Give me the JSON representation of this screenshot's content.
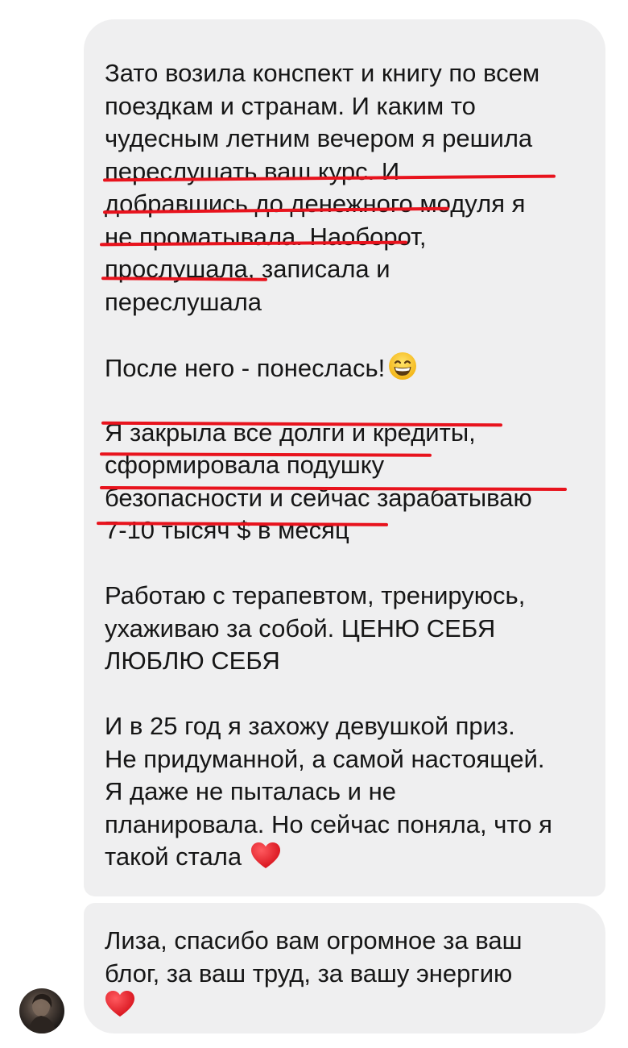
{
  "messages": [
    {
      "paragraphs": [
        {
          "lines": [
            "Зато возила конспект и книгу по всем",
            "поездкам и странам. И каким то",
            "чудесным летним вечером я решила",
            "переслушать ваш курс. И",
            "добравшись до денежного модуля я",
            "не проматывала. Наоборот,",
            "прослушала, записала и",
            "переслушала"
          ]
        },
        {
          "lines": [
            "После него - понеслась!"
          ],
          "emoji": "grinning-face-emoji"
        },
        {
          "lines": [
            "Я закрыла все долги и кредиты,",
            "сформировала подушку",
            "безопасности и сейчас зарабатываю",
            "7-10 тысяч $ в месяц"
          ]
        },
        {
          "lines": [
            "Работаю с терапевтом, тренируюсь,",
            "ухаживаю за собой. ЦЕНЮ СЕБЯ",
            "ЛЮБЛЮ СЕБЯ"
          ]
        },
        {
          "lines": [
            "И в 25 год я захожу девушкой приз.",
            "Не придуманной, а самой настоящей.",
            "Я даже не пыталась и не",
            "планировала. Но сейчас поняла, что я",
            "такой стала"
          ],
          "emoji": "red-heart-emoji"
        }
      ]
    },
    {
      "paragraphs": [
        {
          "lines": [
            "Лиза, спасибо вам огромное за ваш",
            "блог, за ваш труд, за вашу энергию"
          ],
          "emoji": "red-heart-emoji"
        }
      ]
    }
  ],
  "colors": {
    "bubble": "#efeff0",
    "text": "#161616",
    "underline": "#e8131d",
    "heart": "#e0161f",
    "emoji_face": "#f9c623"
  }
}
